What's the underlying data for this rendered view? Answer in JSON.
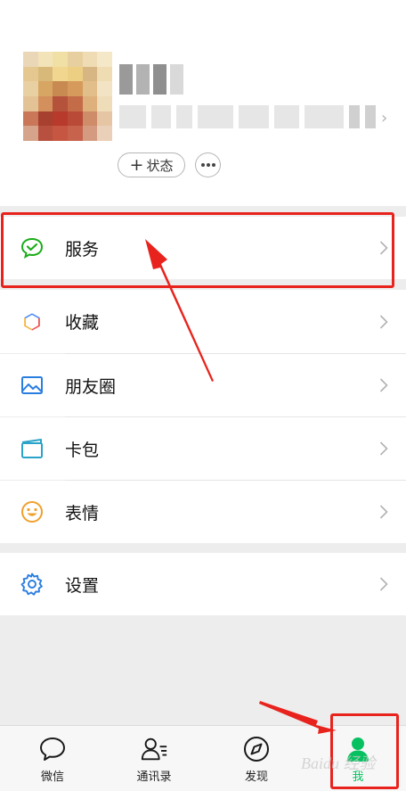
{
  "profile": {
    "status_label": "状态",
    "status_icon": "plus-icon",
    "more_icon": "ellipsis-icon"
  },
  "menu": {
    "services": {
      "label": "服务",
      "icon": "wechat-pay-icon"
    },
    "favorites": {
      "label": "收藏",
      "icon": "cube-icon"
    },
    "moments": {
      "label": "朋友圈",
      "icon": "picture-icon"
    },
    "cards": {
      "label": "卡包",
      "icon": "card-icon"
    },
    "stickers": {
      "label": "表情",
      "icon": "smiley-icon"
    },
    "settings": {
      "label": "设置",
      "icon": "gear-icon"
    }
  },
  "tabbar": {
    "tabs": [
      {
        "label": "微信",
        "icon": "chat-bubble-icon"
      },
      {
        "label": "通讯录",
        "icon": "contacts-icon"
      },
      {
        "label": "发现",
        "icon": "compass-icon"
      },
      {
        "label": "我",
        "icon": "person-icon",
        "active": true
      }
    ]
  },
  "colors": {
    "accent_green": "#07c160",
    "annotation_red": "#e8231d"
  },
  "watermark": "Baidu 经验"
}
